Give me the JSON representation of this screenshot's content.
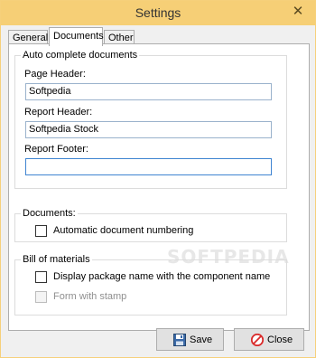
{
  "window": {
    "title": "Settings",
    "close_glyph": "✕"
  },
  "tabs": [
    {
      "label": "General",
      "active": false
    },
    {
      "label": "Documents",
      "active": true
    },
    {
      "label": "Other",
      "active": false
    }
  ],
  "auto_complete": {
    "legend": "Auto complete documents",
    "page_header": {
      "label": "Page Header:",
      "value": "Softpedia"
    },
    "report_header": {
      "label": "Report Header:",
      "value": "Softpedia Stock"
    },
    "report_footer": {
      "label": "Report Footer:",
      "value": ""
    }
  },
  "documents_group": {
    "legend": "Documents:",
    "auto_numbering": {
      "label": "Automatic document numbering",
      "checked": false
    }
  },
  "bill_of_materials": {
    "legend": "Bill of materials",
    "display_package": {
      "label": "Display package name with the component name",
      "checked": false
    },
    "form_with_stamp": {
      "label": "Form with stamp",
      "checked": false,
      "enabled": false
    }
  },
  "watermark": "SOFTPEDIA",
  "buttons": {
    "save": "Save",
    "close": "Close"
  },
  "colors": {
    "titlebar": "#f6cf76",
    "focus_border": "#3f84d1",
    "close_icon": "#d92b2b"
  },
  "icons": {
    "save": "floppy-disk-icon",
    "close": "no-entry-icon"
  }
}
